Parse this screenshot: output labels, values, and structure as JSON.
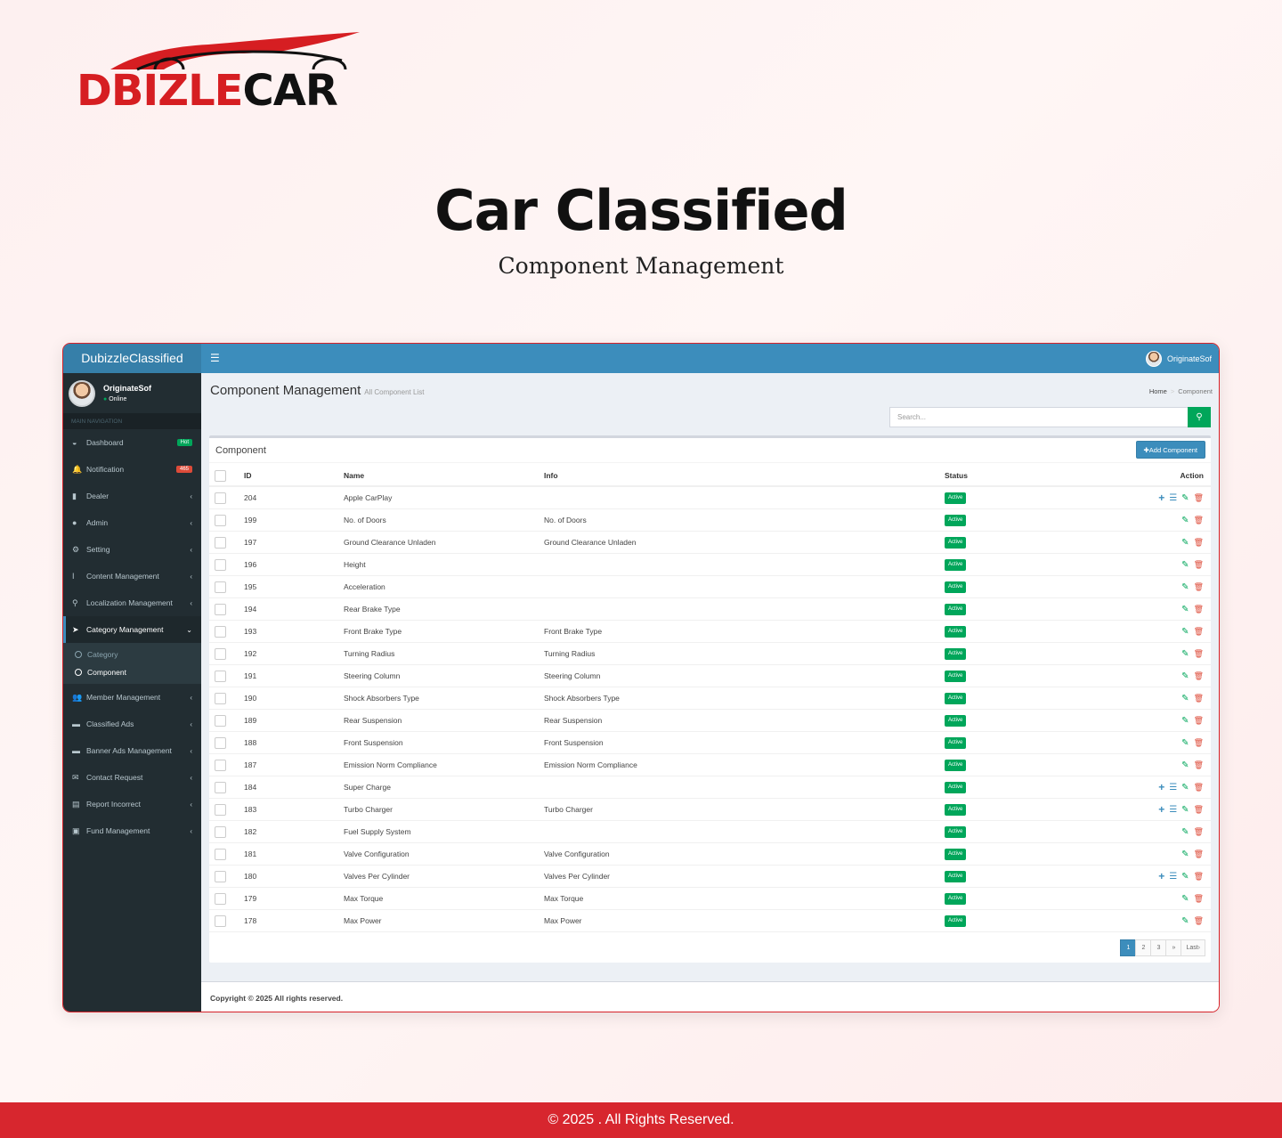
{
  "brand_logo": {
    "word_red": "DBIZLE",
    "word_black": "CAR"
  },
  "hero": {
    "title": "Car Classified",
    "subtitle": "Component Management"
  },
  "app": {
    "brand": "DubizzleClassified",
    "top_user": "OriginateSof",
    "user": {
      "name": "OriginateSof",
      "status": "Online"
    },
    "nav_header": "MAIN NAVIGATION",
    "menu": [
      {
        "label": "Dashboard",
        "icon": "dashboard-icon",
        "glyph": "◒",
        "badge": "Hot"
      },
      {
        "label": "Notification",
        "icon": "bell-icon",
        "glyph": "🔔",
        "badge": "465"
      },
      {
        "label": "Dealer",
        "icon": "bar-chart-icon",
        "glyph": "▮"
      },
      {
        "label": "Admin",
        "icon": "user-icon",
        "glyph": "●"
      },
      {
        "label": "Setting",
        "icon": "gear-icon",
        "glyph": "⚙"
      },
      {
        "label": "Content Management",
        "icon": "text-cursor-icon",
        "glyph": "I"
      },
      {
        "label": "Localization Management",
        "icon": "map-marker-icon",
        "glyph": "⚲"
      },
      {
        "label": "Category Management",
        "icon": "pointer-icon",
        "glyph": "➤"
      },
      {
        "label": "Member Management",
        "icon": "users-icon",
        "glyph": "👥"
      },
      {
        "label": "Classified Ads",
        "icon": "car-icon",
        "glyph": "▬"
      },
      {
        "label": "Banner Ads Management",
        "icon": "banner-icon",
        "glyph": "▬"
      },
      {
        "label": "Contact Request",
        "icon": "envelope-icon",
        "glyph": "✉"
      },
      {
        "label": "Report Incorrect",
        "icon": "file-icon",
        "glyph": "▤"
      },
      {
        "label": "Fund Management",
        "icon": "money-icon",
        "glyph": "▣"
      }
    ],
    "submenu": [
      "Category",
      "Component"
    ],
    "page_title": "Component Management",
    "page_subtitle": "All Component List",
    "breadcrumb": {
      "home": "Home",
      "sep": ">",
      "current": "Component"
    },
    "search_placeholder": "Search...",
    "box_title": "Component",
    "add_button": "Add Component",
    "columns": {
      "id": "ID",
      "name": "Name",
      "info": "Info",
      "status": "Status",
      "action": "Action"
    },
    "rows": [
      {
        "id": "204",
        "name": "Apple CarPlay",
        "info": "",
        "status": "Active",
        "extra": true
      },
      {
        "id": "199",
        "name": "No. of Doors",
        "info": "No. of Doors",
        "status": "Active",
        "extra": false
      },
      {
        "id": "197",
        "name": "Ground Clearance Unladen",
        "info": "Ground Clearance Unladen",
        "status": "Active",
        "extra": false
      },
      {
        "id": "196",
        "name": "Height",
        "info": "",
        "status": "Active",
        "extra": false
      },
      {
        "id": "195",
        "name": "Acceleration",
        "info": "",
        "status": "Active",
        "extra": false
      },
      {
        "id": "194",
        "name": "Rear Brake Type",
        "info": "",
        "status": "Active",
        "extra": false
      },
      {
        "id": "193",
        "name": "Front Brake Type",
        "info": "Front Brake Type",
        "status": "Active",
        "extra": false
      },
      {
        "id": "192",
        "name": "Turning Radius",
        "info": "Turning Radius",
        "status": "Active",
        "extra": false
      },
      {
        "id": "191",
        "name": "Steering Column",
        "info": "Steering Column",
        "status": "Active",
        "extra": false
      },
      {
        "id": "190",
        "name": "Shock Absorbers Type",
        "info": "Shock Absorbers Type",
        "status": "Active",
        "extra": false
      },
      {
        "id": "189",
        "name": "Rear Suspension",
        "info": "Rear Suspension",
        "status": "Active",
        "extra": false
      },
      {
        "id": "188",
        "name": "Front Suspension",
        "info": "Front Suspension",
        "status": "Active",
        "extra": false
      },
      {
        "id": "187",
        "name": "Emission Norm Compliance",
        "info": "Emission Norm Compliance",
        "status": "Active",
        "extra": false
      },
      {
        "id": "184",
        "name": "Super Charge",
        "info": "",
        "status": "Active",
        "extra": true
      },
      {
        "id": "183",
        "name": "Turbo Charger",
        "info": "Turbo Charger",
        "status": "Active",
        "extra": true
      },
      {
        "id": "182",
        "name": "Fuel Supply System",
        "info": "",
        "status": "Active",
        "extra": false
      },
      {
        "id": "181",
        "name": "Valve Configuration",
        "info": "Valve Configuration",
        "status": "Active",
        "extra": false
      },
      {
        "id": "180",
        "name": "Valves Per Cylinder",
        "info": "Valves Per Cylinder",
        "status": "Active",
        "extra": true
      },
      {
        "id": "179",
        "name": "Max Torque",
        "info": "Max Torque",
        "status": "Active",
        "extra": false
      },
      {
        "id": "178",
        "name": "Max Power",
        "info": "Max Power",
        "status": "Active",
        "extra": false
      }
    ],
    "pagination": [
      "1",
      "2",
      "3",
      "»",
      "Last›"
    ],
    "active_page": "1",
    "copyright": "Copyright © 2025 All rights reserved."
  },
  "page_footer": "© 2025 . All Rights Reserved.",
  "colors": {
    "accent": "#3c8dbc",
    "sidebar": "#222d32",
    "success": "#00a65a",
    "danger": "#dd4b39",
    "brand_red": "#d7262e"
  }
}
